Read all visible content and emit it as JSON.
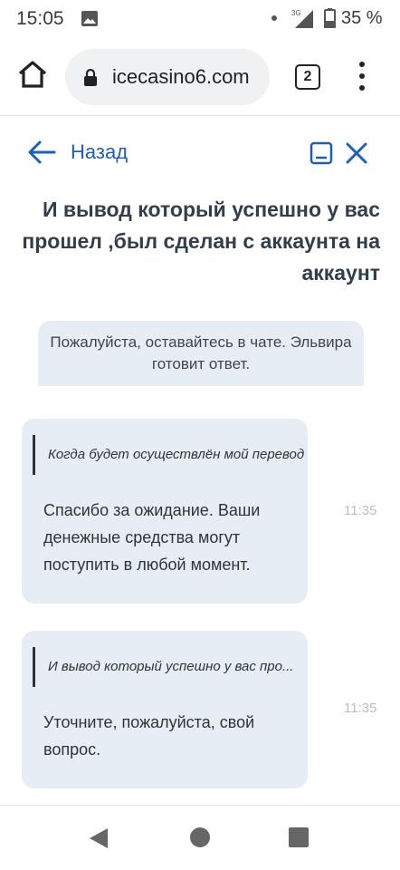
{
  "status_bar": {
    "time": "15:05",
    "network": "3G",
    "battery": "35 %"
  },
  "browser": {
    "url": "icecasino6.com",
    "tabs_count": "2"
  },
  "chat": {
    "back_label": "Назад",
    "title": "И вывод который успешно у вас прошел ,был сделан с аккаунта на аккаунт",
    "system_message": "Пожалуйста, оставайтесь в чате. Эльвира готовит ответ.",
    "messages": [
      {
        "quote": "Когда будет осуществлён мой перевод",
        "text": "Спасибо за ожидание. Ваши денежные средства могут поступить в любой момент.",
        "time": "11:35"
      },
      {
        "quote": "И вывод который успешно у вас про...",
        "text": "Уточните, пожалуйста, свой вопрос.",
        "time": "11:35"
      }
    ]
  },
  "colors": {
    "accent": "#1d5fb8",
    "bubble": "#e7edf5",
    "title_text": "#323d4d"
  }
}
